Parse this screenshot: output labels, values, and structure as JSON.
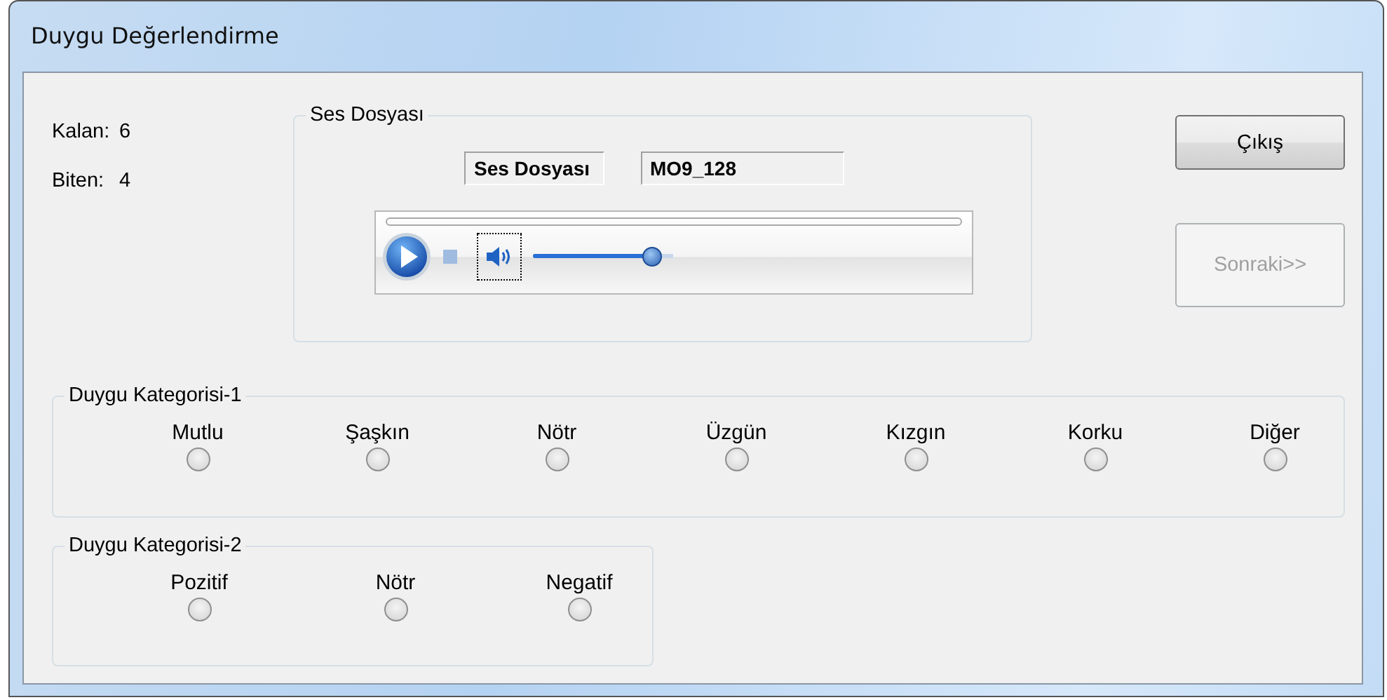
{
  "window": {
    "title": "Duygu Değerlendirme"
  },
  "stats": [
    {
      "label": "Kalan:",
      "value": "6"
    },
    {
      "label": "Biten:",
      "value": "4"
    }
  ],
  "audio_group": {
    "title": "Ses Dosyası",
    "file_label": "Ses Dosyası",
    "file_name": "MO9_128",
    "volume": {
      "level": 0.85
    }
  },
  "buttons": [
    {
      "label": "Çıkış",
      "disabled": false
    },
    {
      "label": "Sonraki>>",
      "disabled": true
    }
  ],
  "category_groups": [
    {
      "title": "Duygu Kategorisi-1",
      "options": [
        {
          "label": "Mutlu",
          "selected": false
        },
        {
          "label": "Şaşkın",
          "selected": false
        },
        {
          "label": "Nötr",
          "selected": false
        },
        {
          "label": "Üzgün",
          "selected": false
        },
        {
          "label": "Kızgın",
          "selected": false
        },
        {
          "label": "Korku",
          "selected": false
        },
        {
          "label": "Diğer",
          "selected": false
        }
      ]
    },
    {
      "title": "Duygu Kategorisi-2",
      "options": [
        {
          "label": "Pozitif",
          "selected": false
        },
        {
          "label": "Nötr",
          "selected": false
        },
        {
          "label": "Negatif",
          "selected": false
        }
      ]
    }
  ]
}
